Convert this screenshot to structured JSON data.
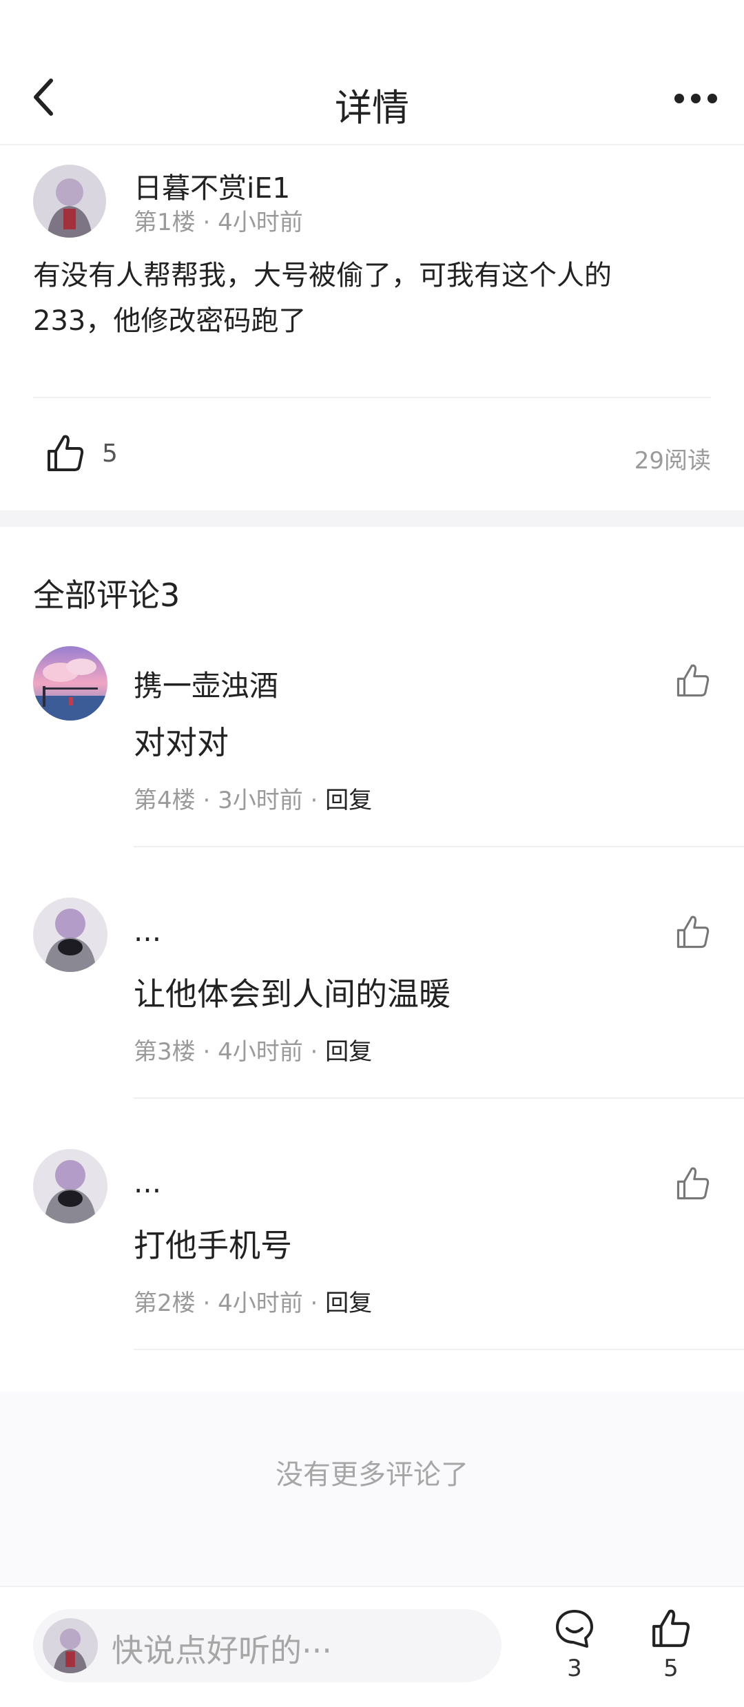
{
  "header": {
    "title": "详情"
  },
  "post": {
    "author": "日暮不赏iE1",
    "floor": "第1楼",
    "time": "4小时前",
    "content_line1": "有没有人帮帮我，大号被偷了，可我有这个人的",
    "content_line2": "233，他修改密码跑了",
    "likes": "5",
    "reads": "29阅读"
  },
  "comments_section": {
    "title": "全部评论3",
    "items": [
      {
        "name": "携一壶浊酒",
        "text": "对对对",
        "floor": "第4楼",
        "time": "3小时前",
        "reply": "回复"
      },
      {
        "name": "...",
        "text": "让他体会到人间的温暖",
        "floor": "第3楼",
        "time": "4小时前",
        "reply": "回复"
      },
      {
        "name": "...",
        "text": "打他手机号",
        "floor": "第2楼",
        "time": "4小时前",
        "reply": "回复"
      }
    ],
    "no_more": "没有更多评论了"
  },
  "bottom_bar": {
    "placeholder": "快说点好听的···",
    "comment_count": "3",
    "like_count": "5"
  },
  "colors": {
    "text": "#222222",
    "muted": "#9a9a9a",
    "divider": "#f0f0f2"
  },
  "icons": [
    "back-arrow-icon",
    "more-dots-icon",
    "thumbs-up-icon",
    "comment-bubble-icon"
  ]
}
